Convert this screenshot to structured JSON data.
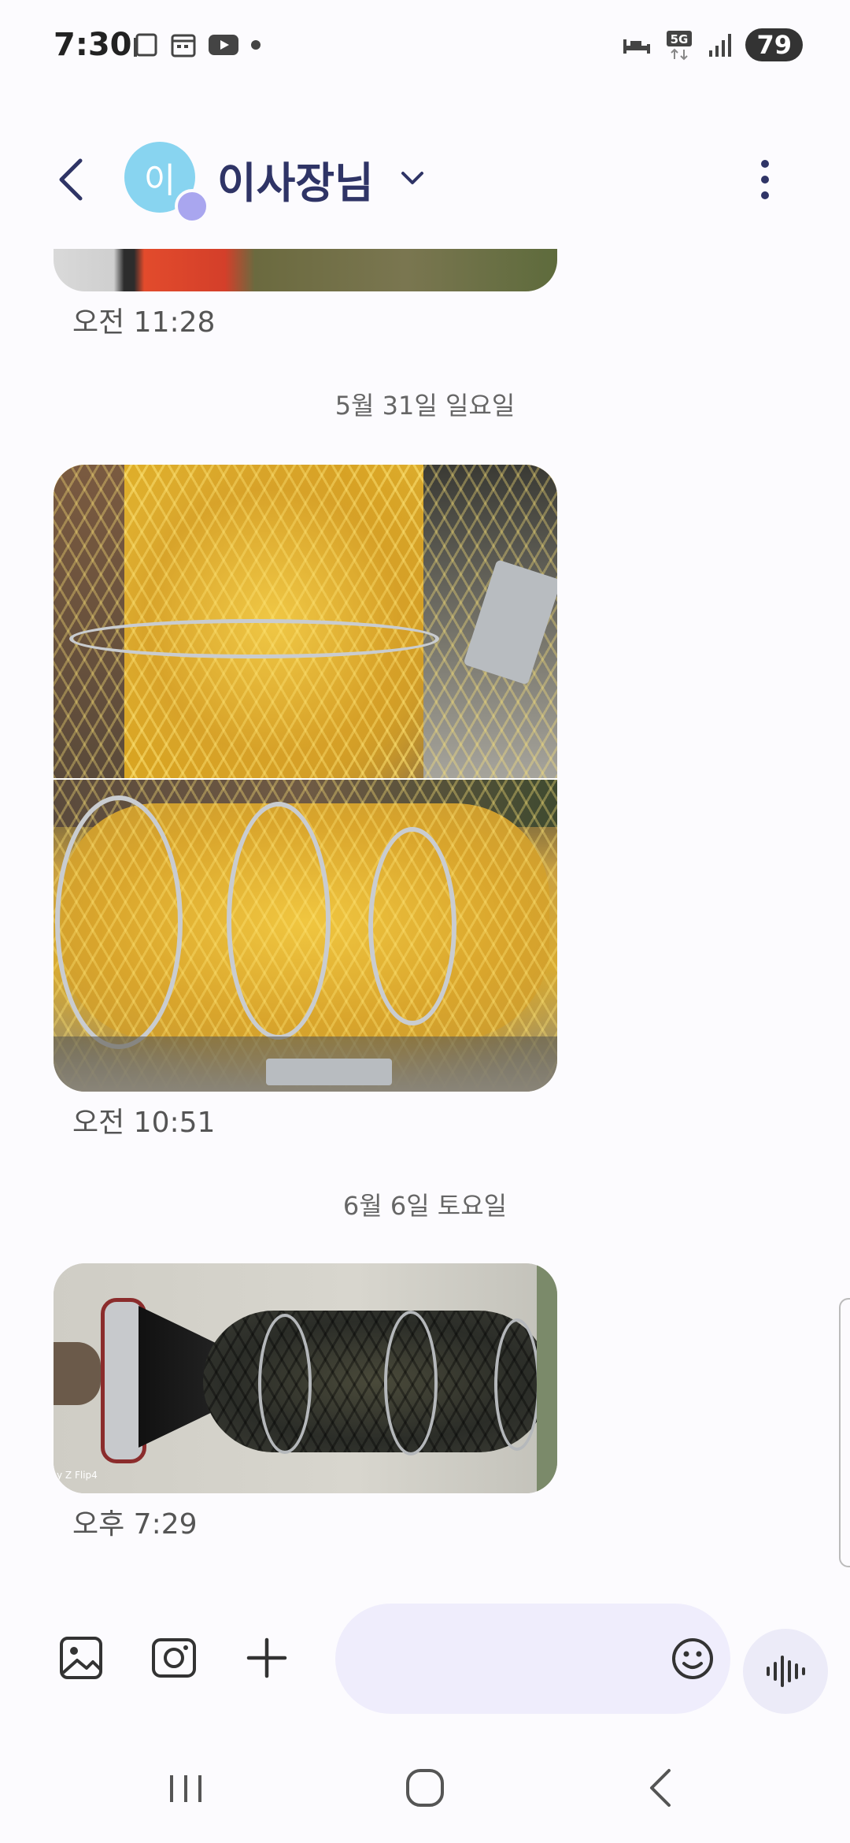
{
  "status_bar": {
    "time": "7:30",
    "battery": "79",
    "network": "5G",
    "left_icons": [
      "copy-icon",
      "calendar-icon",
      "youtube-icon",
      "dot-icon"
    ],
    "right_icons": [
      "sleep-mode-icon",
      "5g-icon",
      "signal-icon",
      "battery-icon"
    ]
  },
  "header": {
    "avatar_initial": "이",
    "contact_name": "이사장님"
  },
  "messages": [
    {
      "type": "image",
      "time": "오전 11:28"
    },
    {
      "type": "date",
      "label": "5월 31일 일요일"
    },
    {
      "type": "image",
      "time": "오전 10:51"
    },
    {
      "type": "date",
      "label": "6월 6일 토요일"
    },
    {
      "type": "image",
      "time": "오후 7:29"
    }
  ],
  "photo_watermark": "y Z Flip4",
  "composer": {
    "buttons": [
      "gallery-icon",
      "camera-icon",
      "plus-icon",
      "emoji-icon",
      "voice-icon"
    ],
    "placeholder": ""
  },
  "colors": {
    "accent": "#2f3466",
    "input_bg": "#efedfc",
    "avatar": "#88d4f0"
  }
}
